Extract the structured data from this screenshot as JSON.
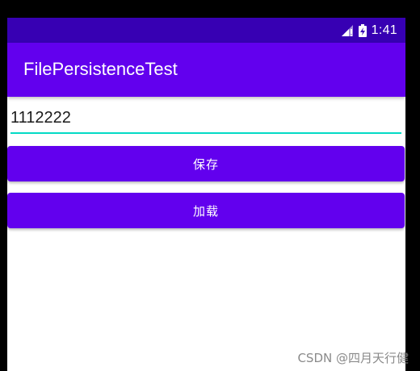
{
  "status_bar": {
    "time": "1:41",
    "icons": [
      "signal-icon",
      "battery-charging-icon"
    ]
  },
  "app_bar": {
    "title": "FilePersistenceTest"
  },
  "edit_text": {
    "value": "1112222"
  },
  "buttons": {
    "save_label": "保存",
    "load_label": "加载"
  },
  "watermark": "CSDN @四月天行健",
  "colors": {
    "status_bar": "#3700b3",
    "primary": "#6200ee",
    "accent": "#03dac5",
    "background": "#ffffff"
  }
}
